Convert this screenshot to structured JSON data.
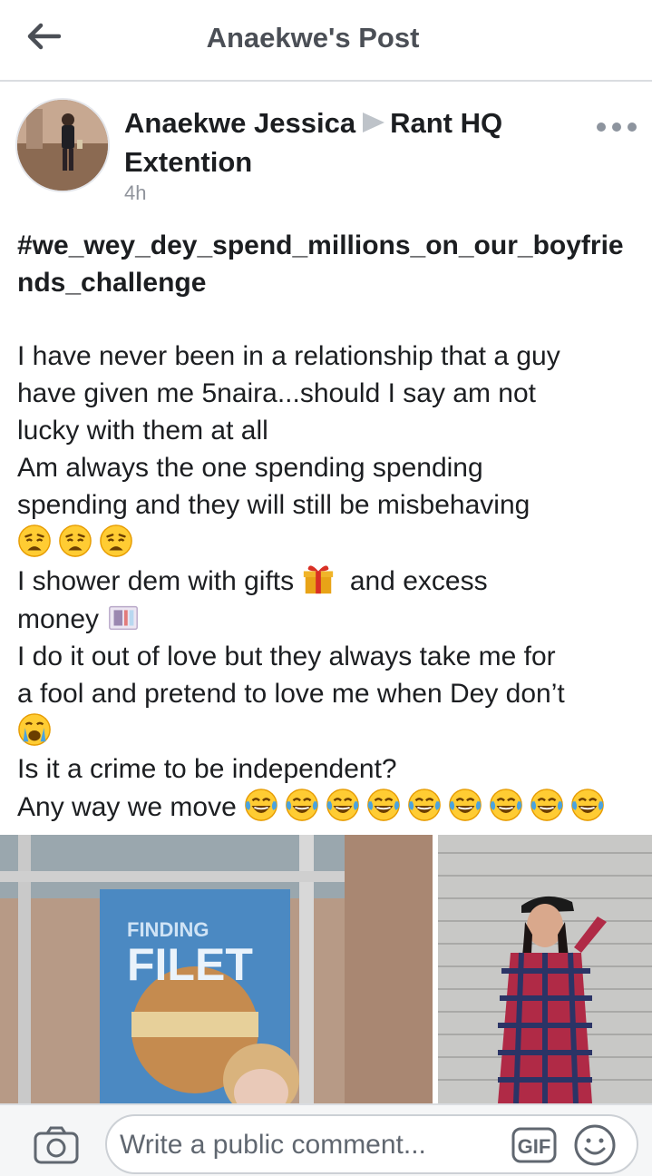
{
  "topbar": {
    "back_icon": "back-arrow-icon",
    "title": "Anaekwe's Post"
  },
  "post": {
    "author": "Anaekwe Jessica",
    "arrow_icon": "triangle-right-icon",
    "group": "Rant HQ Extention",
    "time": "4h",
    "more_icon": "more-horizontal-icon",
    "hashtag": "#we_wey_dey_spend_millions_on_our_boyfriends_challenge",
    "lines": [
      "I have never been in a relationship that a guy",
      "have given me 5naira...should I say am not",
      "lucky with them at all",
      "Am always the one spending spending",
      "spending and they will still be misbehaving",
      "I shower dem with gifts",
      "and excess",
      "money",
      "I do it out of love but they always take me for",
      "a fool and pretend to love me when Dey don’t",
      "Is it a crime to be independent?",
      "Any way we move"
    ],
    "emojis": {
      "weary": "weary-face-icon",
      "gift": "gift-icon",
      "money": "money-with-wings-icon",
      "crying": "crying-face-icon",
      "laughing": "tears-of-joy-icon"
    },
    "photos": [
      {
        "name": "photo-woman-braids",
        "caption_visible": "FINDING FILET"
      },
      {
        "name": "photo-woman-plaid-shirt"
      }
    ]
  },
  "comment_bar": {
    "camera_icon": "camera-icon",
    "placeholder": "Write a public comment...",
    "gif_label": "GIF",
    "emoji_icon": "smiley-icon"
  }
}
